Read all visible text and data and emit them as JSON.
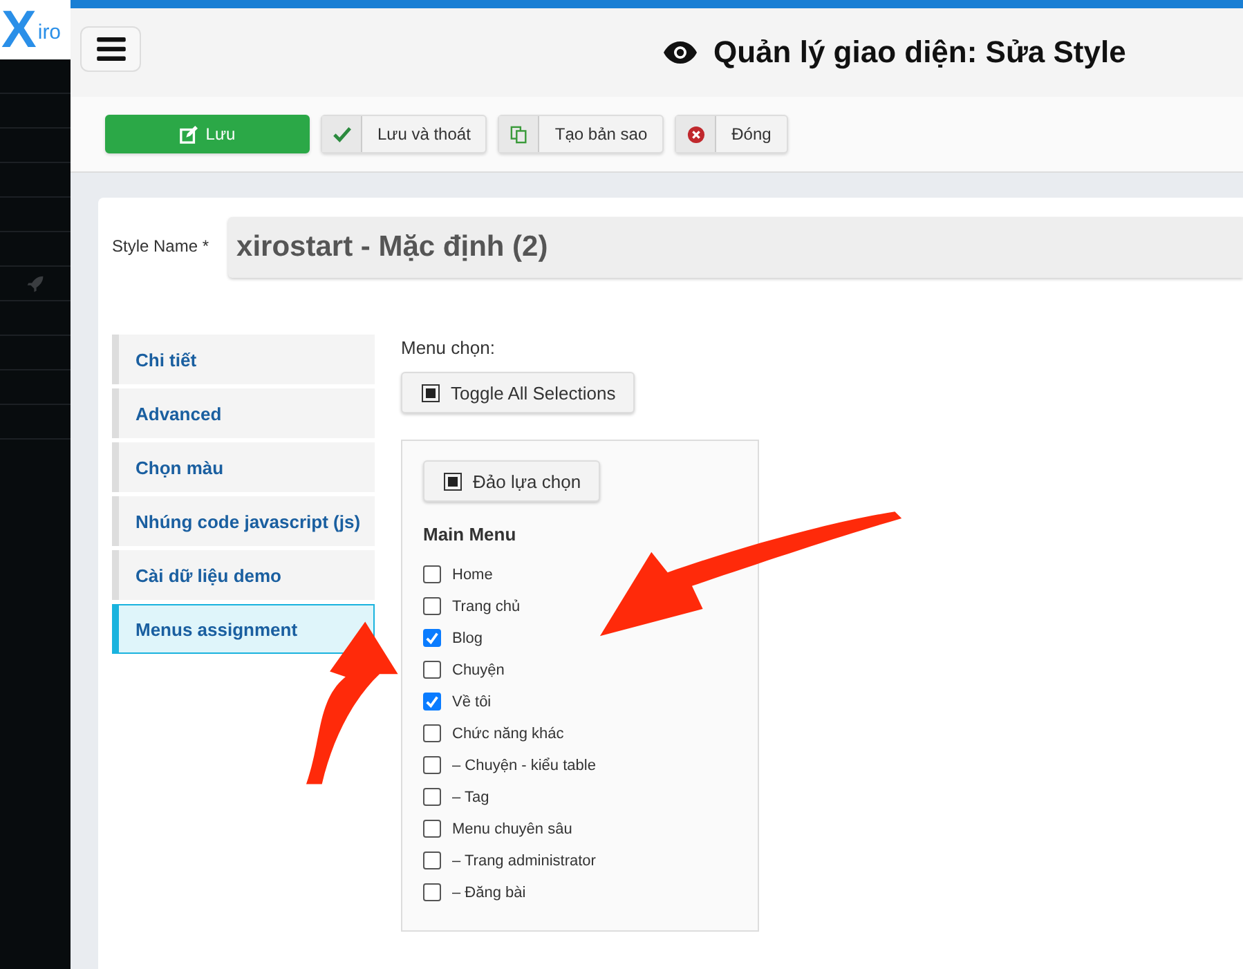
{
  "logo": {
    "mark": "X",
    "text": "iro"
  },
  "page_title": "Quản lý giao diện: Sửa Style",
  "toolbar": [
    {
      "kind": "save",
      "label": "Lưu"
    },
    {
      "kind": "save_close",
      "label": "Lưu và thoát"
    },
    {
      "kind": "copy",
      "label": "Tạo bản sao"
    },
    {
      "kind": "close",
      "label": "Đóng"
    }
  ],
  "style_name": {
    "label": "Style Name *",
    "value": "xirostart - Mặc định (2)"
  },
  "tabs": [
    {
      "label": "Chi tiết",
      "selected": false
    },
    {
      "label": "Advanced",
      "selected": false
    },
    {
      "label": "Chọn màu",
      "selected": false
    },
    {
      "label": "Nhúng code javascript (js)",
      "selected": false
    },
    {
      "label": "Cài dữ liệu demo",
      "selected": false
    },
    {
      "label": "Menus assignment",
      "selected": true
    }
  ],
  "menu_label": "Menu chọn:",
  "toggle_button": "Toggle All Selections",
  "invert_button": "Đảo lựa chọn",
  "menu_group": "Main Menu",
  "menu_items": [
    {
      "label": "Home",
      "checked": false
    },
    {
      "label": "Trang chủ",
      "checked": false
    },
    {
      "label": "Blog",
      "checked": true
    },
    {
      "label": "Chuyện",
      "checked": false
    },
    {
      "label": "Về tôi",
      "checked": true
    },
    {
      "label": "Chức năng khác",
      "checked": false
    },
    {
      "label": "– Chuyện - kiểu table",
      "checked": false
    },
    {
      "label": "– Tag",
      "checked": false
    },
    {
      "label": "Menu chuyên sâu",
      "checked": false
    },
    {
      "label": "– Trang administrator",
      "checked": false
    },
    {
      "label": "– Đăng bài",
      "checked": false
    }
  ]
}
